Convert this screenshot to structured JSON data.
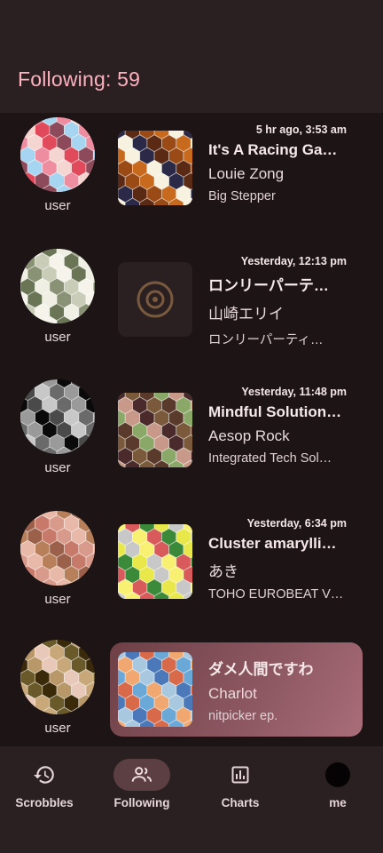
{
  "header": {
    "title": "Following: 59"
  },
  "feed": [
    {
      "user": "user",
      "time": "5 hr ago, 3:53 am",
      "track": "It's A Racing Ga…",
      "artist": "Louie Zong",
      "album": "Big Stepper",
      "now_playing": false,
      "avatar_colors": [
        "#ee8da0",
        "#d35a6a",
        "#a5d5f0",
        "#f7c0c0",
        "#8c4a5a",
        "#f1a8b0",
        "#e04a5a",
        "#6a6a8a",
        "#f5d5d0",
        "#b23a4a"
      ],
      "art_colors": [
        "#c86a1e",
        "#f7e8c8",
        "#9a4a14",
        "#f3f0d8",
        "#5a2a14",
        "#e8a85a",
        "#2a2a48",
        "#b56a2a",
        "#f7f2e0",
        "#7a3a1a"
      ]
    },
    {
      "user": "user",
      "time": "Yesterday, 12:13 pm",
      "track": "ロンリーパーテ…",
      "artist": "山崎エリイ",
      "album": "ロンリーパーティ…",
      "now_playing": false,
      "avatar_colors": [
        "#f0efe4",
        "#d6d5c8",
        "#6a7556",
        "#b5b8a0",
        "#f5f3ea",
        "#4f5a40",
        "#c9ccb6",
        "#e6e5da",
        "#8a9275",
        "#ffffff"
      ],
      "art_colors": []
    },
    {
      "user": "user",
      "time": "Yesterday, 11:48 pm",
      "track": "Mindful Solution…",
      "artist": "Aesop Rock",
      "album": "Integrated Tech Sol…",
      "now_playing": false,
      "avatar_colors": [
        "#0a0a0a",
        "#3a3a3a",
        "#9a9a9a",
        "#1a1a1a",
        "#6a6a6a",
        "#050505",
        "#c8c8c8",
        "#2a2a2a",
        "#4a4a4a",
        "#0e0e0e"
      ],
      "art_colors": [
        "#8aa868",
        "#e8b8a0",
        "#5a3a2a",
        "#b88a6a",
        "#7a5a3a",
        "#d8c8a0",
        "#4a2a2a",
        "#a8b890",
        "#c89888",
        "#6a4a3a"
      ]
    },
    {
      "user": "user",
      "time": "Yesterday, 6:34 pm",
      "track": "Cluster amarylli…",
      "artist": "あき",
      "album": "TOHO EUROBEAT V…",
      "now_playing": false,
      "avatar_colors": [
        "#b8805a",
        "#c8906a",
        "#e8b8a8",
        "#a0704a",
        "#d89a8a",
        "#6a7ab8",
        "#c87a6a",
        "#f0c8c0",
        "#9a604a",
        "#b03a4a"
      ],
      "art_colors": [
        "#e8e84a",
        "#b8d86a",
        "#3a8a3a",
        "#f0d8a0",
        "#d85a5a",
        "#a8a84a",
        "#f8f070",
        "#8ab848",
        "#c8c8c8",
        "#f0b8b8"
      ]
    },
    {
      "user": "user",
      "time": "",
      "track": "ダメ人間ですわ",
      "artist": "Charlot",
      "album": "nitpicker ep.",
      "now_playing": true,
      "avatar_colors": [
        "#3a2a0a",
        "#f0d0a0",
        "#6a5a2a",
        "#1a1a0a",
        "#c8a878",
        "#8a7a4a",
        "#e8c8b8",
        "#4a3a1a",
        "#b89868",
        "#2a2a1a"
      ],
      "art_colors": [
        "#6aa8d8",
        "#c8d8e8",
        "#d86a4a",
        "#f0c88a",
        "#4a78b8",
        "#e8e8e8",
        "#a8c8e0",
        "#3a5a98",
        "#f0a870",
        "#8ab8e0"
      ]
    }
  ],
  "nav": [
    {
      "label": "Scrobbles",
      "icon": "history-icon",
      "active": false
    },
    {
      "label": "Following",
      "icon": "people-icon",
      "active": true
    },
    {
      "label": "Charts",
      "icon": "bar-chart-icon",
      "active": false
    },
    {
      "label": "me",
      "icon": "profile-avatar-icon",
      "active": false
    }
  ]
}
